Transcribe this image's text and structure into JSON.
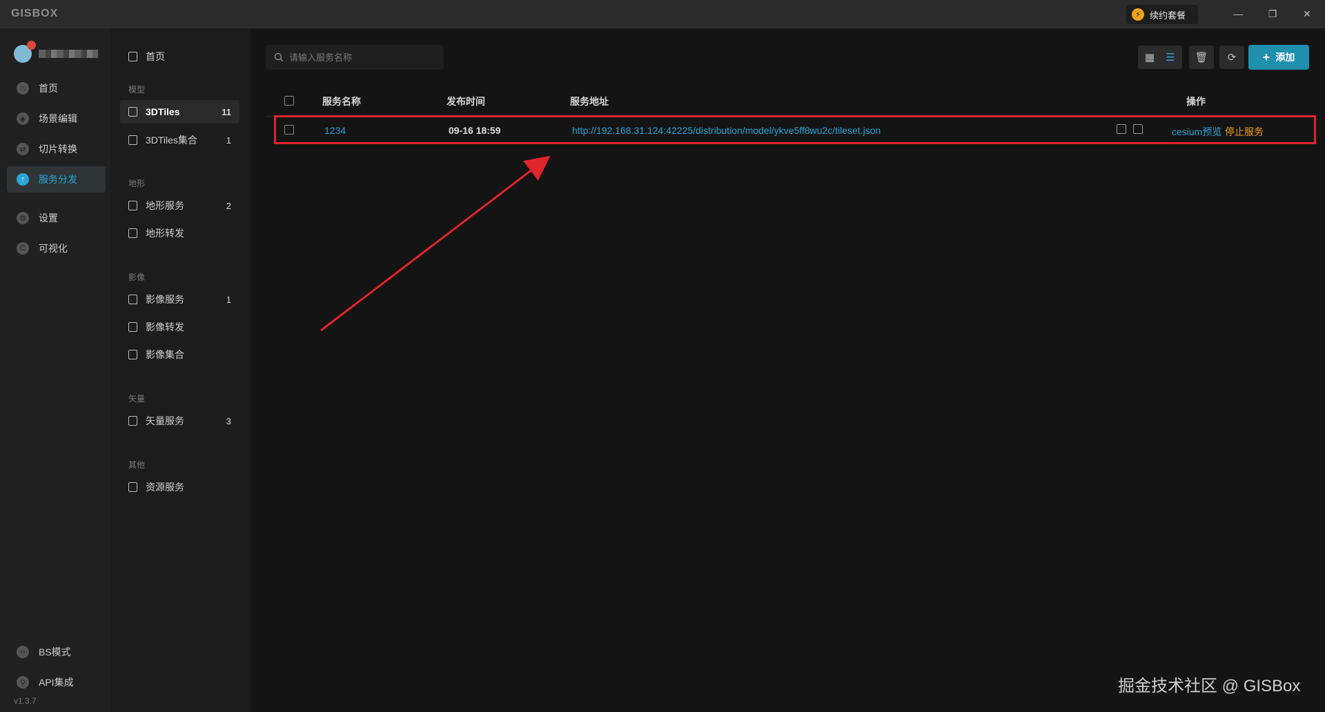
{
  "titlebar": {
    "logo": "GISBOX",
    "renew_label": "续约套餐",
    "minimize": "—",
    "restore": "❐",
    "close": "✕"
  },
  "sidebar": {
    "items": [
      {
        "label": "首页",
        "icon": "home-icon"
      },
      {
        "label": "场景编辑",
        "icon": "cube-icon"
      },
      {
        "label": "切片转换",
        "icon": "swap-icon"
      },
      {
        "label": "服务分发",
        "icon": "upload-icon",
        "active": true
      },
      {
        "label": "设置",
        "icon": "gear-icon"
      },
      {
        "label": "可视化",
        "icon": "visual-icon"
      }
    ],
    "bottom_items": [
      {
        "label": "BS模式",
        "icon": "code-icon"
      },
      {
        "label": "API集成",
        "icon": "api-icon"
      }
    ],
    "version": "v1.3.7"
  },
  "categories": {
    "home": "首页",
    "groups": [
      {
        "title": "模型",
        "items": [
          {
            "label": "3DTiles",
            "count": "11",
            "active": true
          },
          {
            "label": "3DTiles集合",
            "count": "1"
          }
        ]
      },
      {
        "title": "地形",
        "items": [
          {
            "label": "地形服务",
            "count": "2"
          },
          {
            "label": "地形转发",
            "count": ""
          }
        ]
      },
      {
        "title": "影像",
        "items": [
          {
            "label": "影像服务",
            "count": "1"
          },
          {
            "label": "影像转发",
            "count": ""
          },
          {
            "label": "影像集合",
            "count": ""
          }
        ]
      },
      {
        "title": "矢量",
        "items": [
          {
            "label": "矢量服务",
            "count": "3"
          }
        ]
      },
      {
        "title": "其他",
        "items": [
          {
            "label": "资源服务",
            "count": ""
          }
        ]
      }
    ]
  },
  "main": {
    "search_placeholder": "请输入服务名称",
    "add_label": "添加",
    "columns": {
      "name": "服务名称",
      "time": "发布时间",
      "url": "服务地址",
      "actions": "操作"
    },
    "rows": [
      {
        "name": "1234",
        "time": "09-16 18:59",
        "url": "http://192.168.31.124:42225/distribution/model/ykve5ff8wu2c/tileset.json",
        "preview": "cesium预览",
        "stop": "停止服务"
      }
    ]
  },
  "watermark": "掘金技术社区 @ GISBox",
  "colors": {
    "accent": "#2aa5d6",
    "warning": "#f0a21b",
    "highlight": "#e0242c",
    "add_button": "#1f8fad"
  }
}
